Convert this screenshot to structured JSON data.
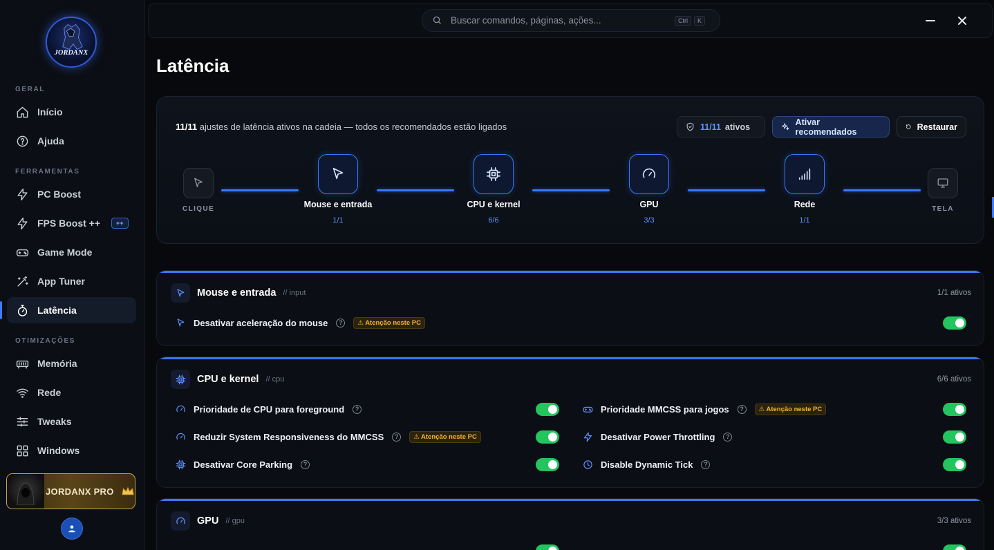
{
  "app": {
    "logo_text": "JORDANX"
  },
  "sidebar": {
    "sections": [
      "GERAL",
      "FERRAMENTAS",
      "OTIMIZAÇÕES"
    ],
    "items": [
      {
        "label": "Início",
        "icon": "home-icon"
      },
      {
        "label": "Ajuda",
        "icon": "help-circle-icon"
      },
      {
        "label": "PC Boost",
        "icon": "lightning-icon"
      },
      {
        "label": "FPS Boost ++",
        "icon": "lightning-icon",
        "badge": "++"
      },
      {
        "label": "Game Mode",
        "icon": "gamepad-icon"
      },
      {
        "label": "App Tuner",
        "icon": "magic-wand-icon"
      },
      {
        "label": "Latência",
        "icon": "stopwatch-icon",
        "active": true
      },
      {
        "label": "Memória",
        "icon": "memory-icon"
      },
      {
        "label": "Rede",
        "icon": "wifi-icon"
      },
      {
        "label": "Tweaks",
        "icon": "sliders-icon"
      },
      {
        "label": "Windows",
        "icon": "grid-icon"
      }
    ],
    "pro_label": "JORDANX PRO"
  },
  "topbar": {
    "search_placeholder": "Buscar comandos, páginas, ações...",
    "shortcut_ctrl": "Ctrl",
    "shortcut_key": "K"
  },
  "page": {
    "title": "Latência"
  },
  "chain": {
    "summary_count": "11/11",
    "summary_text": " ajustes de latência ativos na cadeia — todos os recomendados estão ligados",
    "active_num": "11/11",
    "active_label": "ativos",
    "recommend_label": "Ativar recomendados",
    "reset_label": "Restaurar",
    "start_label": "CLIQUE",
    "end_label": "TELA",
    "nodes": [
      {
        "label": "Mouse e entrada",
        "count": "1/1"
      },
      {
        "label": "CPU e kernel",
        "count": "6/6"
      },
      {
        "label": "GPU",
        "count": "3/3"
      },
      {
        "label": "Rede",
        "count": "1/1"
      }
    ]
  },
  "sections": {
    "mouse": {
      "title": "Mouse e entrada",
      "tag": "// input",
      "count": "1/1 ativos",
      "options": [
        {
          "label": "Desativar aceleração do mouse",
          "warn": "⚠ Atenção neste PC",
          "on": true
        }
      ]
    },
    "cpu": {
      "title": "CPU e kernel",
      "tag": "// cpu",
      "count": "6/6 ativos",
      "options": [
        {
          "label": "Prioridade de CPU para foreground",
          "on": true
        },
        {
          "label": "Prioridade MMCSS para jogos",
          "warn": "⚠ Atenção neste PC",
          "on": true
        },
        {
          "label": "Reduzir System Responsiveness do MMCSS",
          "warn": "⚠ Atenção neste PC",
          "on": true
        },
        {
          "label": "Desativar Power Throttling",
          "on": true
        },
        {
          "label": "Desativar Core Parking",
          "on": true
        },
        {
          "label": "Disable Dynamic Tick",
          "on": true
        }
      ]
    },
    "gpu": {
      "title": "GPU",
      "tag": "// gpu",
      "count": "3/3 ativos"
    }
  },
  "colors": {
    "accent": "#3a78ff",
    "toggle_on": "#22c55e",
    "warning": "#f2b431"
  }
}
